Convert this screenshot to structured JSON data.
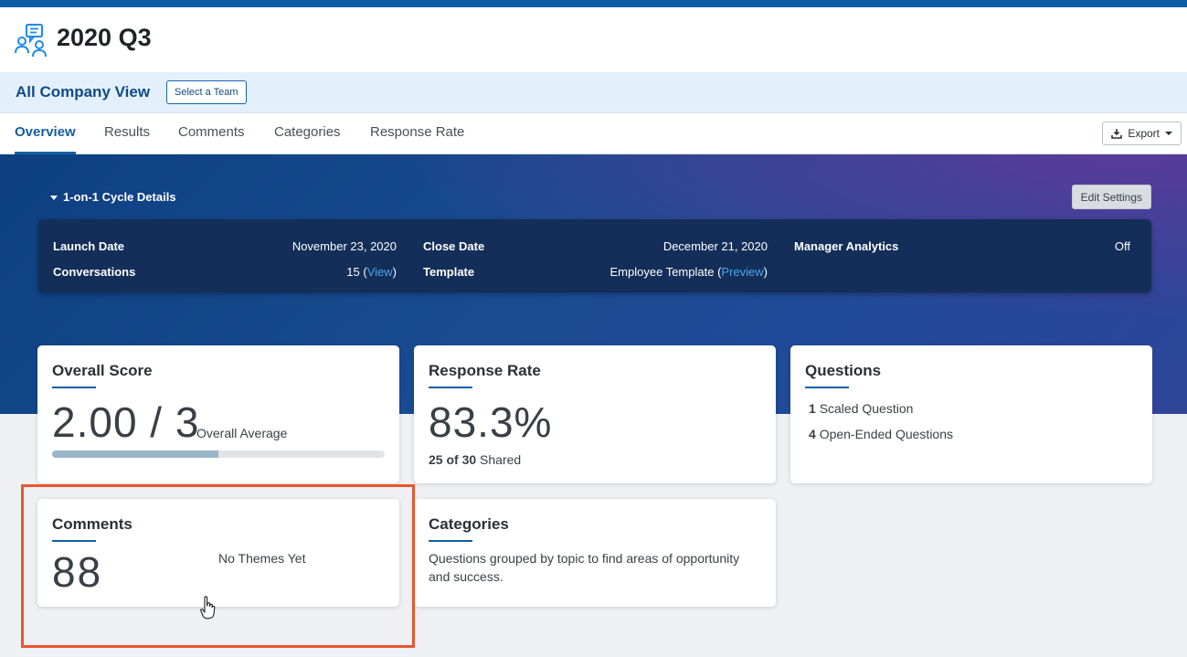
{
  "header": {
    "title": "2020 Q3",
    "icon": "survey-people-icon"
  },
  "team_bar": {
    "view_label": "All Company View",
    "select_team_label": "Select a Team"
  },
  "tabs": [
    {
      "label": "Overview",
      "active": true
    },
    {
      "label": "Results",
      "active": false
    },
    {
      "label": "Comments",
      "active": false
    },
    {
      "label": "Categories",
      "active": false
    },
    {
      "label": "Response Rate",
      "active": false
    }
  ],
  "export_label": "Export",
  "cycle": {
    "toggle_label": "1-on-1 Cycle Details",
    "edit_settings_label": "Edit Settings",
    "launch_date_label": "Launch Date",
    "launch_date": "November 23, 2020",
    "conversations_label": "Conversations",
    "conversations_count": "15",
    "conversations_link": "View",
    "close_date_label": "Close Date",
    "close_date": "December 21, 2020",
    "template_label": "Template",
    "template_name": "Employee Template",
    "template_link": "Preview",
    "manager_analytics_label": "Manager Analytics",
    "manager_analytics_value": "Off"
  },
  "overall_score": {
    "title": "Overall Score",
    "value": "2.00 / 3",
    "caption": "Overall Average",
    "progress": 0.5
  },
  "response_rate": {
    "title": "Response Rate",
    "value": "83.3%",
    "shared_count": "25 of 30",
    "shared_label": "Shared"
  },
  "questions": {
    "title": "Questions",
    "scaled_count": "1",
    "scaled_label": "Scaled Question",
    "open_count": "4",
    "open_label": "Open-Ended Questions"
  },
  "comments": {
    "title": "Comments",
    "value": "88",
    "themes_text": "No Themes Yet"
  },
  "categories": {
    "title": "Categories",
    "description": "Questions grouped by topic to find areas of opportunity and success."
  },
  "colors": {
    "brand": "#145fa4",
    "highlight": "#e8562f",
    "link": "#4aa8f0"
  }
}
